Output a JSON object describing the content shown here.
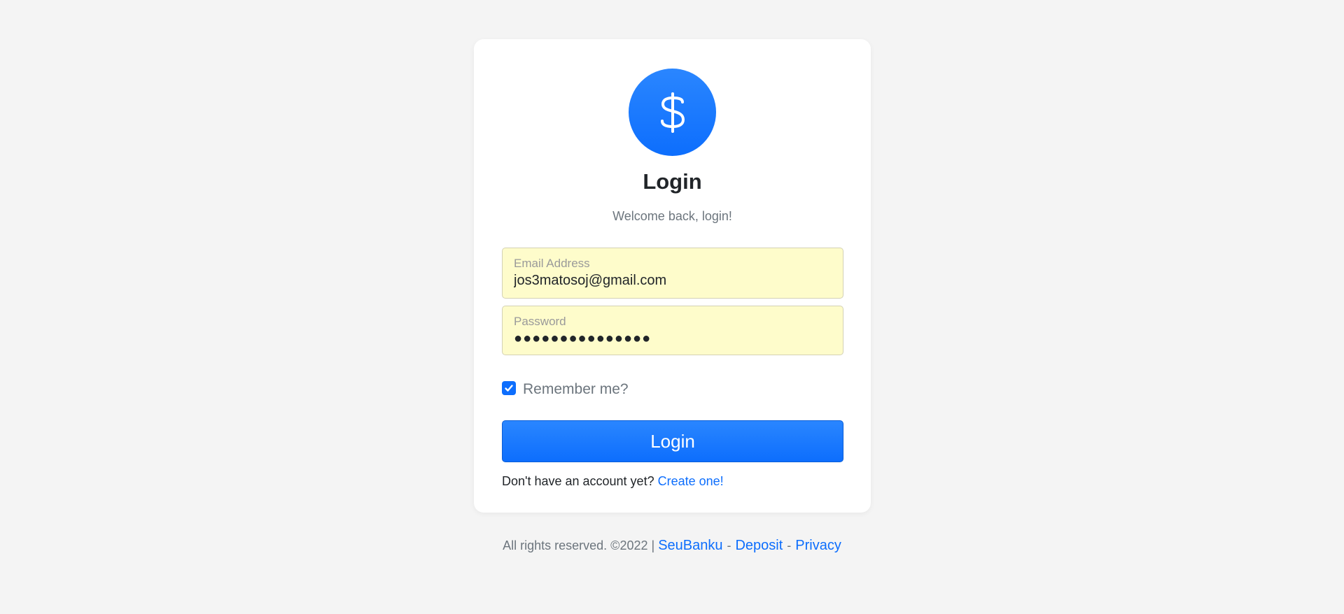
{
  "brand": {
    "logo_icon": "dollar-sign-icon",
    "accent": "#0d6efd"
  },
  "header": {
    "title": "Login",
    "subtitle": "Welcome back, login!"
  },
  "form": {
    "email": {
      "label": "Email Address",
      "value": "jos3matosoj@gmail.com"
    },
    "password": {
      "label": "Password",
      "value": "●●●●●●●●●●●●●●●"
    },
    "remember": {
      "label": "Remember me?",
      "checked": true
    },
    "submit_label": "Login"
  },
  "signup": {
    "prompt": "Don't have an account yet?",
    "link": "Create one!"
  },
  "footer": {
    "copyright": "All rights reserved. ©2022 |",
    "links": [
      "SeuBanku",
      "Deposit",
      "Privacy"
    ],
    "separator": "-"
  }
}
